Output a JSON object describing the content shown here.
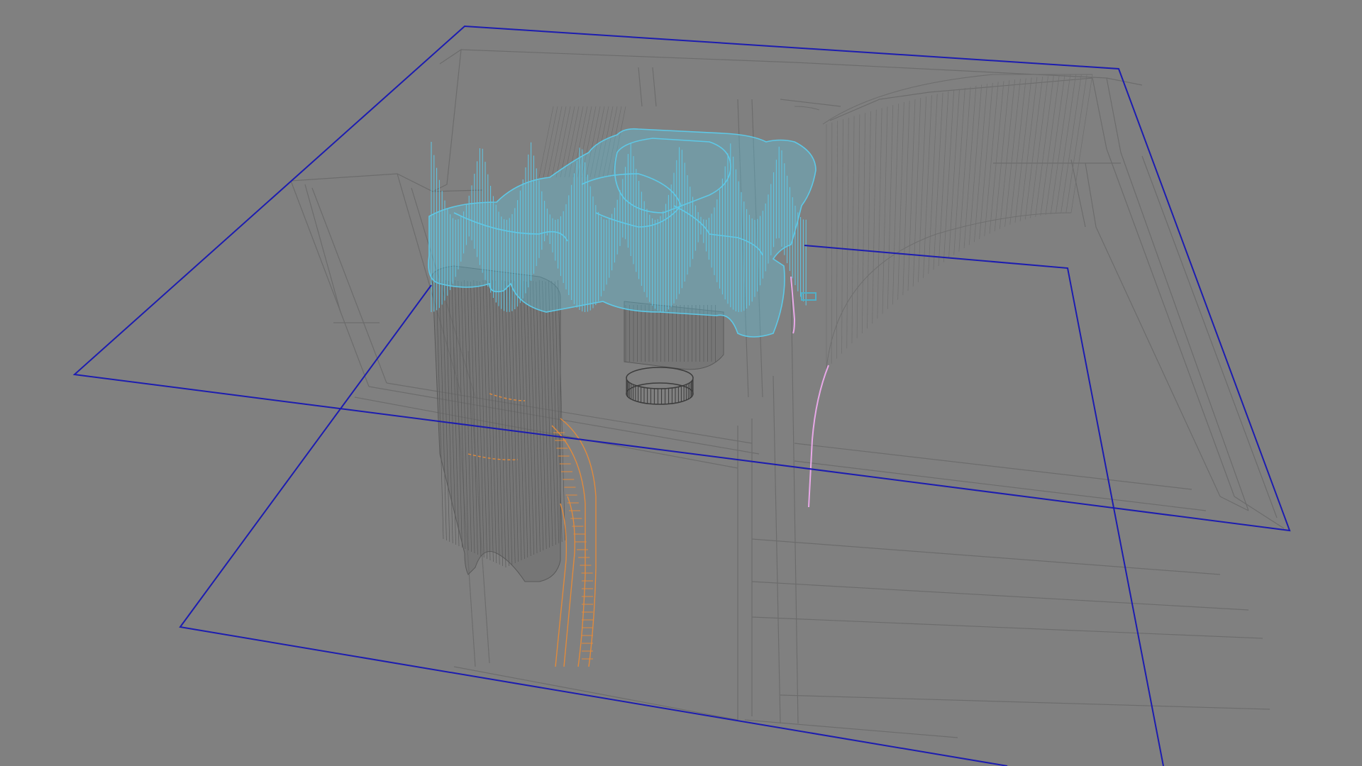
{
  "viewport": {
    "kind": "3D wireframe perspective viewport",
    "background_color": "#808080",
    "objects": [
      {
        "name": "upper-plane-outline",
        "color": "#1c1cb0",
        "role": "section plane"
      },
      {
        "name": "lower-plane-outline",
        "color": "#1c1cb0",
        "role": "section plane"
      },
      {
        "name": "room-walls",
        "color": "#6c6c6c",
        "role": "building shell"
      },
      {
        "name": "canopy-structure",
        "color": "#5ec8e6",
        "role": "selected object"
      },
      {
        "name": "column-cluster",
        "color": "#5a5a5a",
        "role": "support structure"
      },
      {
        "name": "ring-base",
        "color": "#3c3c3c",
        "role": "footing"
      },
      {
        "name": "orange-ramp",
        "color": "#e08a3c",
        "role": "curved path"
      },
      {
        "name": "pink-path",
        "color": "#e8a8e8",
        "role": "curved path"
      }
    ]
  }
}
